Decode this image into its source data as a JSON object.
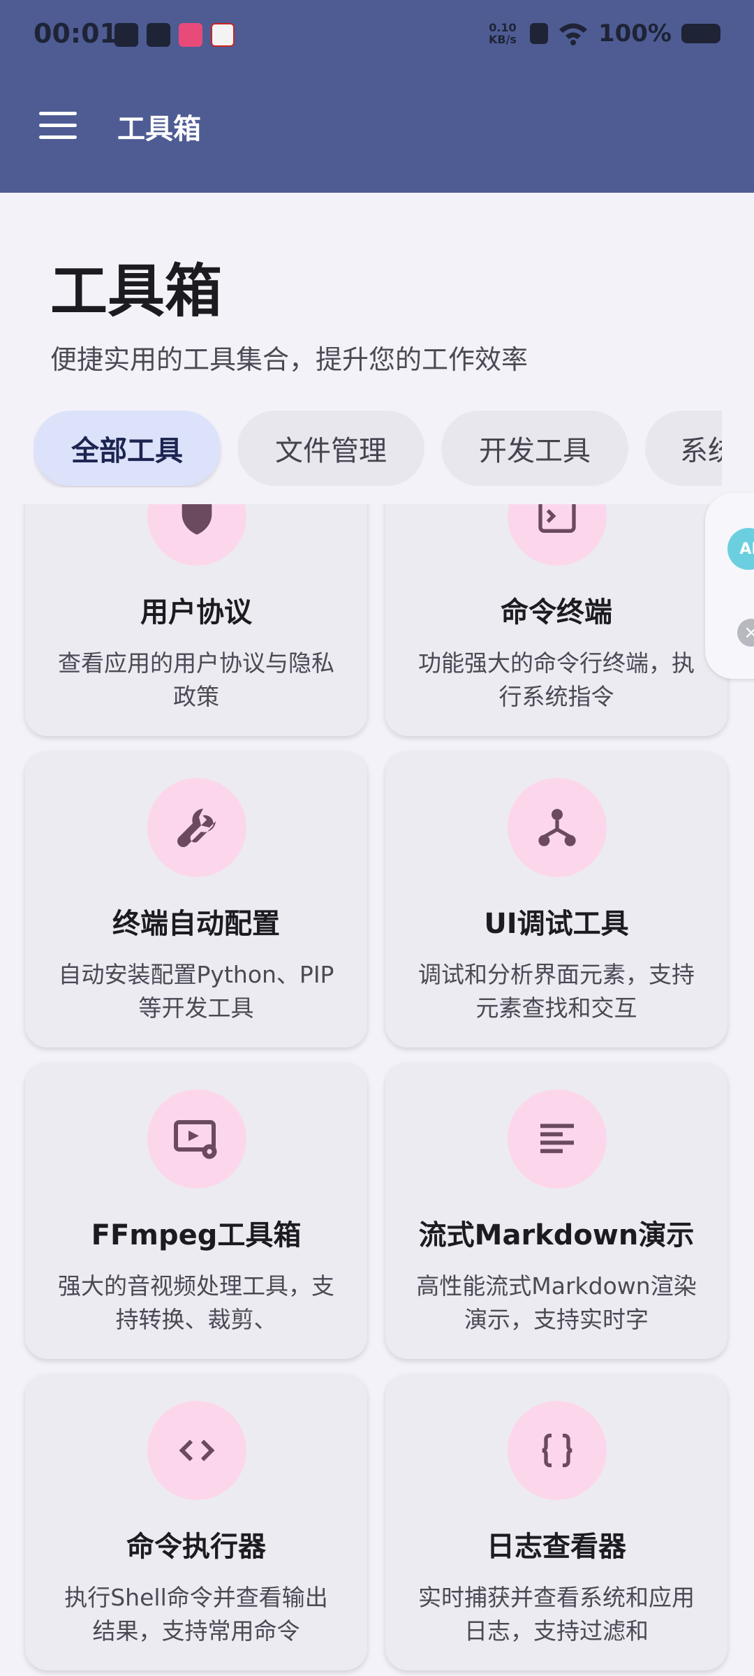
{
  "status_bar": {
    "time": "00:01",
    "net_speed_value": "0.10",
    "net_speed_unit": "KB/s",
    "battery": "100%"
  },
  "app_bar": {
    "title": "工具箱",
    "menu_icon": "menu-icon"
  },
  "header": {
    "title": "工具箱",
    "subtitle": "便捷实用的工具集合，提升您的工作效率"
  },
  "categories": [
    {
      "label": "全部工具",
      "selected": true
    },
    {
      "label": "文件管理"
    },
    {
      "label": "开发工具"
    },
    {
      "label": "系统"
    }
  ],
  "tools": [
    {
      "title": "用户协议",
      "desc": "查看应用的用户协议与隐私政策",
      "icon": "shield-icon"
    },
    {
      "title": "命令终端",
      "desc": "功能强大的命令行终端，执行系统指令",
      "icon": "terminal-icon"
    },
    {
      "title": "终端自动配置",
      "desc": "自动安装配置Python、PIP等开发工具",
      "icon": "wrench-icon"
    },
    {
      "title": "UI调试工具",
      "desc": "调试和分析界面元素，支持元素查找和交互",
      "icon": "hierarchy-icon"
    },
    {
      "title": "FFmpeg工具箱",
      "desc": "强大的音视频处理工具，支持转换、裁剪、",
      "icon": "video-settings-icon"
    },
    {
      "title": "流式Markdown演示",
      "desc": "高性能流式Markdown渲染演示，支持实时字",
      "icon": "text-lines-icon"
    },
    {
      "title": "命令执行器",
      "desc": "执行Shell命令并查看输出结果，支持常用命令",
      "icon": "code-icon"
    },
    {
      "title": "日志查看器",
      "desc": "实时捕获并查看系统和应用日志，支持过滤和",
      "icon": "braces-icon"
    }
  ],
  "floating_widget": {
    "label": "AI"
  },
  "colors": {
    "app_bar": "#4e5c93",
    "chip_active": "#dde2fb",
    "icon_bg": "#fcd7ec",
    "icon_fg": "#6b4a5e"
  }
}
